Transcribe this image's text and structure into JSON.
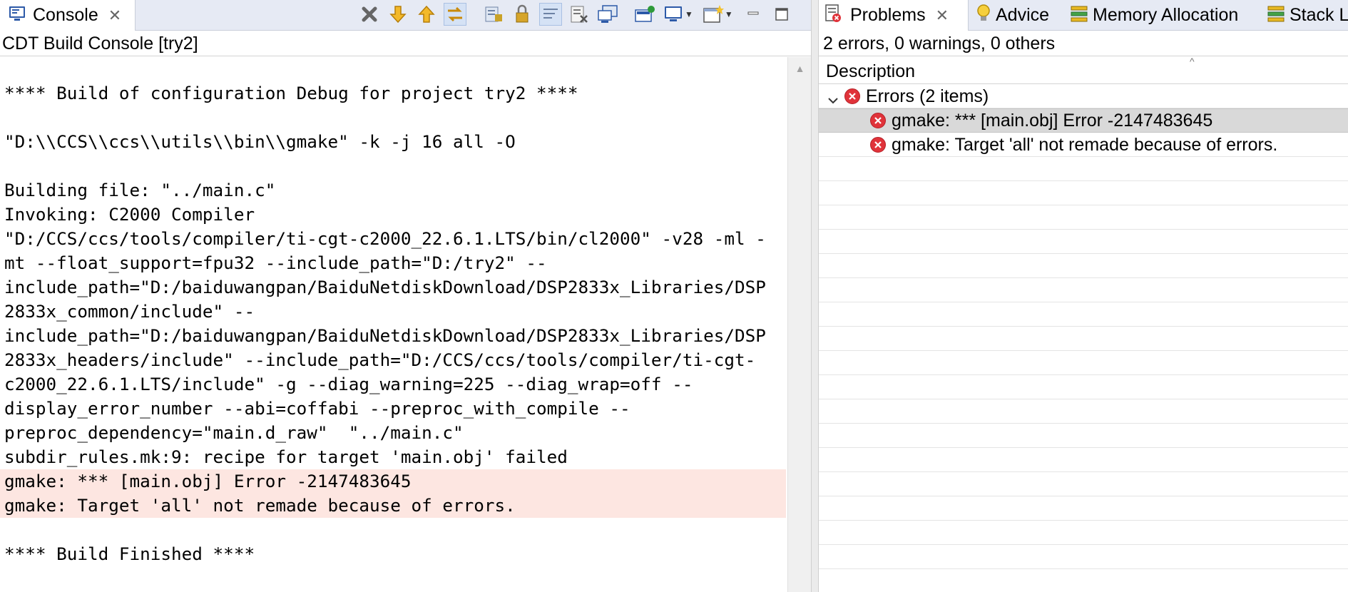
{
  "console": {
    "tab_label": "Console",
    "header": "CDT Build Console [try2]",
    "lines": [
      {
        "text": ""
      },
      {
        "text": "**** Build of configuration Debug for project try2 ****"
      },
      {
        "text": ""
      },
      {
        "text": "\"D:\\\\CCS\\\\ccs\\\\utils\\\\bin\\\\gmake\" -k -j 16 all -O"
      },
      {
        "text": ""
      },
      {
        "text": "Building file: \"../main.c\""
      },
      {
        "text": "Invoking: C2000 Compiler"
      },
      {
        "text": "\"D:/CCS/ccs/tools/compiler/ti-cgt-c2000_22.6.1.LTS/bin/cl2000\" -v28 -ml -"
      },
      {
        "text": "mt --float_support=fpu32 --include_path=\"D:/try2\" --"
      },
      {
        "text": "include_path=\"D:/baiduwangpan/BaiduNetdiskDownload/DSP2833x_Libraries/DSP"
      },
      {
        "text": "2833x_common/include\" --"
      },
      {
        "text": "include_path=\"D:/baiduwangpan/BaiduNetdiskDownload/DSP2833x_Libraries/DSP"
      },
      {
        "text": "2833x_headers/include\" --include_path=\"D:/CCS/ccs/tools/compiler/ti-cgt-"
      },
      {
        "text": "c2000_22.6.1.LTS/include\" -g --diag_warning=225 --diag_wrap=off --"
      },
      {
        "text": "display_error_number --abi=coffabi --preproc_with_compile --"
      },
      {
        "text": "preproc_dependency=\"main.d_raw\"  \"../main.c\""
      },
      {
        "text": "subdir_rules.mk:9: recipe for target 'main.obj' failed"
      },
      {
        "text": "gmake: *** [main.obj] Error -2147483645",
        "error": true
      },
      {
        "text": "gmake: Target 'all' not remade because of errors.",
        "error": true
      },
      {
        "text": ""
      },
      {
        "text": "**** Build Finished ****"
      }
    ],
    "toolbar_icons": [
      "terminate-icon",
      "next-error-icon",
      "previous-error-icon",
      "link-editor-icon",
      "scroll-lock-icon",
      "pin-console-icon",
      "word-wrap-icon",
      "clear-console-icon",
      "copy-build-log-icon",
      "display-console-icon",
      "open-console-icon",
      "new-console-icon",
      "minimize-icon",
      "maximize-icon"
    ]
  },
  "problems": {
    "tabs": [
      {
        "label": "Problems",
        "icon": "problems-icon",
        "active": true
      },
      {
        "label": "Advice",
        "icon": "lightbulb-icon"
      },
      {
        "label": "Memory Allocation",
        "icon": "memory-icon"
      },
      {
        "label": "Stack L",
        "icon": "stack-icon"
      }
    ],
    "summary": "2 errors, 0 warnings, 0 others",
    "column_header": "Description",
    "group": {
      "label": "Errors (2 items)",
      "expanded": true
    },
    "items": [
      {
        "text": "gmake: *** [main.obj] Error -2147483645",
        "selected": true
      },
      {
        "text": "gmake: Target 'all' not remade because of errors."
      }
    ]
  },
  "colors": {
    "error_highlight": "#fde6e1",
    "error_icon": "#e0333a",
    "tabbar_bg": "#e6eaf4",
    "selection_bg": "#d9d9d9"
  }
}
